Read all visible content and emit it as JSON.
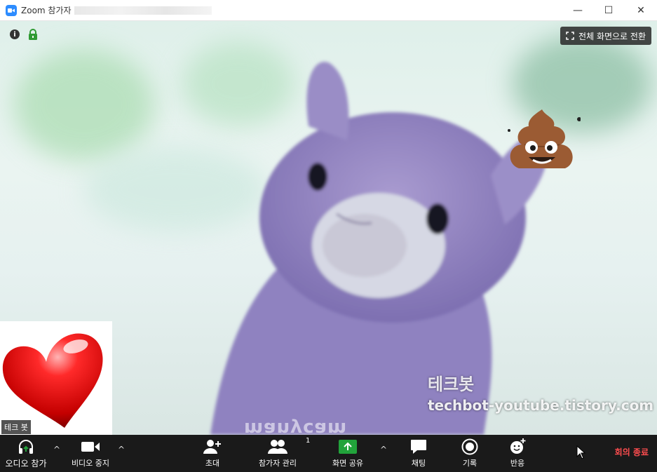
{
  "titlebar": {
    "title": "Zoom 참가자",
    "minimize": "—",
    "maximize": "☐",
    "close": "✕"
  },
  "video": {
    "fullscreen_label": "전체 화면으로 전환",
    "info_glyph": "i",
    "participant_name": "테크 봇",
    "watermark_korean": "테크봇",
    "watermark_url": "techbot-youtube.tistory.com",
    "manycam_text": "manycam"
  },
  "toolbar": {
    "audio_label": "오디오 참가",
    "video_label": "비디오 중지",
    "invite_label": "초대",
    "participants_label": "참가자 관리",
    "participants_count": "1",
    "share_label": "화면 공유",
    "chat_label": "채팅",
    "record_label": "기록",
    "reactions_label": "반응",
    "end_label": "회의 종료",
    "caret": "^"
  },
  "colors": {
    "accent": "#2d8cff",
    "share_green": "#22a33b",
    "end_red": "#ff4d4f",
    "toolbar_bg": "#1a1a1a"
  }
}
